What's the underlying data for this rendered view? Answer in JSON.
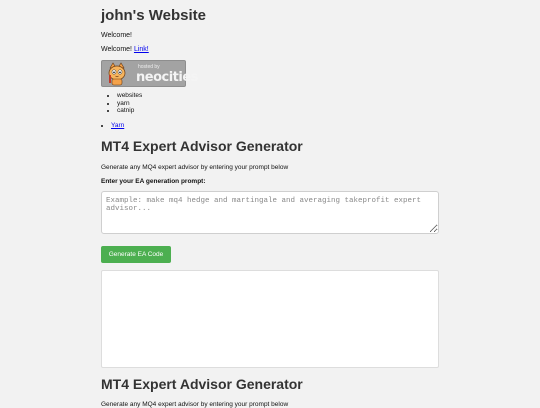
{
  "header": {
    "title": "john's Website"
  },
  "intro": {
    "welcome": "Welcome!",
    "welcome2": "Welcome!",
    "link": "Link!"
  },
  "badge": {
    "hosted": "hosted by",
    "brand": "neocities",
    "icon": "cat-icon"
  },
  "list": [
    "websites",
    "yarn",
    "catnip"
  ],
  "list2": [
    "Yarn"
  ],
  "generator": {
    "title": "MT4 Expert Advisor Generator",
    "description": "Generate any MQ4 expert advisor by entering your prompt below",
    "prompt_label": "Enter your EA generation prompt:",
    "prompt_placeholder": "Example: make mq4 hedge and martingale and averaging takeprofit expert advisor...",
    "button": "Generate EA Code",
    "button_color": "#4caf50"
  },
  "generator2": {
    "title": "MT4 Expert Advisor Generator",
    "description": "Generate any MQ4 expert advisor by entering your prompt below"
  }
}
